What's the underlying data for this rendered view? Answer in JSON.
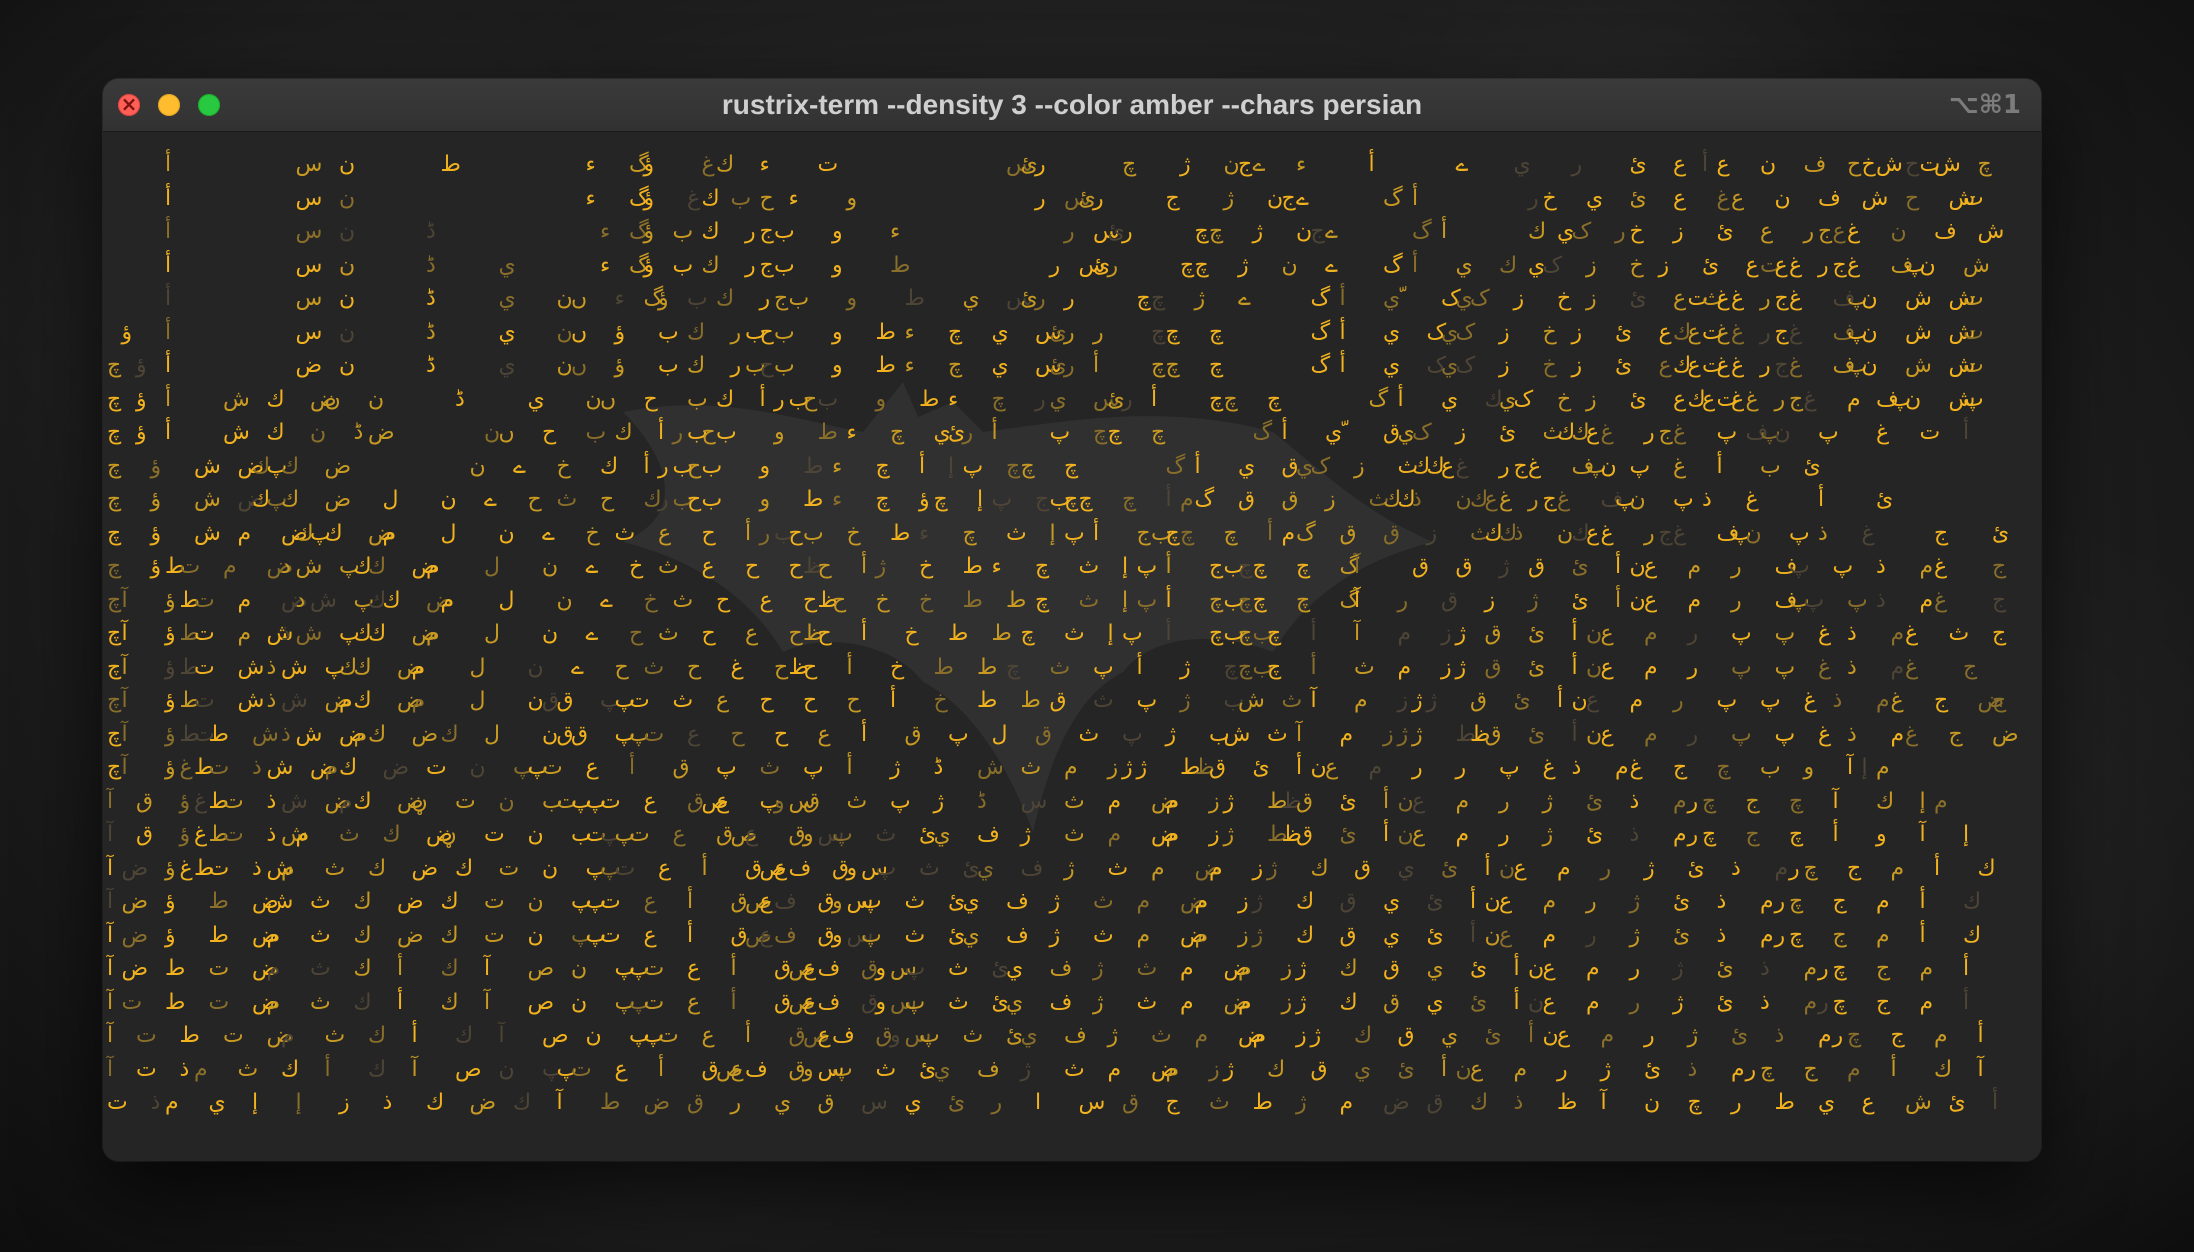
{
  "window": {
    "title": "rustrix-term --density 3 --color amber --chars persian",
    "shortcut": "⌥⌘1"
  },
  "traffic_lights": {
    "close": "close-icon",
    "minimize": "minimize-icon",
    "maximize": "maximize-icon"
  },
  "colors": {
    "bright": "#f2b21e",
    "mid": "#c99a22",
    "dim": "#8a6f2a",
    "faint": "#4e4536"
  },
  "terminal": {
    "rows": [
      "    أ        س  ن      ط         ء  گؤ   غك  ء   ت            سئر     چ   ژ  نجے  ء    أ     ے   ي   ر   ئ  ع أع  ن  ف  حخش حتش  چ     بم",
      "    أ        س  ن                ء  گؤ  غك ب ح ء   و            ر سئر    ج   ژ  نجے     گ أ       رخ  ي  ئ  ع  غع  ن  ف  ش  ح  شت  چ  أ  بم",
      "    أ        س  ن     ڈ           ء گؤ ب ك  رجب   و   ء           ر سئر    چچ  ژ  نجے     گ أ     ك يک  رخ  ز  ئ  ع  رجعغ  ن  ف  ش  ح  شت  چ  أ  بم",
      "    أ        س  ن     ڈ    ي      ء گؤ ب ك  رجب   و   ط          ر سئر    چچ  ژ  ن  ے   گ أ  ي  ك يک  ز  خ ز  ئ  عتعغ رجغ  فپن  ش  ح  شت  أ  بم",
      "    أ        س  ن     ڈ    ي   نں  ء گؤ ب ك  رجب   و   ط   ي  سئر ر    چچ  ژ  ے    گ أ  يّ  کيک  ز  خ ز  ئ  عتثغغ رجغ  فپن  ش  شت  أ  بم  ئ",
      " ؤ  أ        س  ن     ڈ    ي   نں  ؤ  ب ك  ربحب   و  ط ء  چ  ي  سئر ر   چچ  چ      گ أ  ي  کيک  ز  خ ز  ئ  عكعتغغ رجغ  فپن  ش  شت  أ  ضبم  ئ",
      "چ ؤ أ        ض  ن     ڈ    ي   نں  ؤ  ب ك  ربحب   و  ط ء  چ  ي  سئر أ   چچ  چ      گ أ  ي  کيک  ز  خ ز  ئ  عكعتغغ رجغ  فپن  ش  شت  أ  بم  ئ",
      "چ ؤ أ   ش  ك  ضن  ن     ڈ    ي   نں  ح  ب ك  أربحب   و  ط ء  چ  ري  سئر أ   چچ  چ      گ أ  ي  كيک  خ ز  ئ  عكعتغغ رجغ  م فپن  شپ  غ  ت  ت أ  بم  ئ",
      "چ ؤ أ   ش  ك  ن  ڈض       نں  ح  ب ك  أربحب   و  ط ء  چ  يئر أ   پ  چچ  چ      گ أ  يّ  قيک  ز  ئ  ثككعغ  رجغ  پ فپن  پ   غ  ت  أ  بمے  ئ",
      "چ  ؤ  ش  ضكپك  ض         ن  ے  خ  ك  أربحب   و  ط ء  چ  أ إپ  چچ  چ      گ أ  ي  قيک  ز  ثككعغ  رجغ  فپن پ  غ  أ  ب  ئ",
      "چ  ؤ  ش  ضكپك  ض   ل   ن  ے  ح ث  ح  كربحب   و  ط ء  چ  ؤچ  إپ  جبچچ  چ  أمگ  ق  ق  ز  ثككذ  نكعغ رجغ  فپن  پ ذ  غ    أ   ئ",
      "چ  ؤ  ش  م  ضكپك  ضم   ل   ن  ے  خ ث  ع  ح  أربحب  خ  ط ء  چ  ث  إپ أ  جبچچ  چ  أمگ  ق  ق  ز  ثككذ  نكعغ  رجغ  فپن  پ ذ  غ    ج   ئ",
      "چ  ؤطت  م  ضدش  پكك  ضم   ل   ن  ے  خ ث  ع  ح  حظح  أژ  خ  ط ء  چ  ث  إپ أ  جبچچ  چ  گآ   ق  ق  ژ ق  ئ  أنع  م  ر  فپ  پ  ذ  مغ   ج   ئ",
      "چآ  ؤطت  م  ضدش  پكك  ضم   ل   ن  ے  خ ث  ح  ع  حظح  خ  خ  ط  ط چ  ث  إپ أ  چبچچ  چ  گآ  ر  ق  ز  ژ  ئ  أنع  م  ر  فپپ  پ ذ  مغ   ج  آئ",
      "چآ  ؤطت  م شذش  پكك  ضم   ل   ن  ے  ح ث  ح  ع  حظح  أ  خ  ط  ط چ  ث  إپ  أ  چبچبچ  أ  آ  م  زژ ق  ئ  أنع  م  ر  پ  پ  غ ذ  مغ  ث  ج  آئإم",
      "چآ  ؤطت  ش ذش  پكك  ضم   ل   ن  ے  ح ث  ح  غ  حظح  أ  خ  ط  ط چ  ث  پ  أ  ژ  چچبچ  أ  ث  م  زژ ق  ئ  أنع  م  ر  پ  پ  غ ذ  مغ   ج  آئإم",
      "چآ  ؤطت  ش ذش  ضمك  ضم   ل   نقق  پپت  ث  ع  ح  ح  ح  أ  خ  ط  ط ق  ث  پ  ژ  بش  ث آ  م  زژژ  ق  ئ  أنع  م  ر  پ  پ  غ ذ  مغ  ج  ضج  ئآإم",
      "چآ  ؤطتط  ش ذش  ضمك  ض ك  ل   نقق  پپت  ع  ح  ح  ع  أ  ق  پ  ل  ق  ث  پ  ژ  بش  ث آ  م  زژژ  طظق  ئ  أنع  م  ر  پ  پ  غ ذ  مغ  ج  ضج  آإم",
      "چآ  ؤغطت  ذش  ضمك  ض  ت  ن  پپت  ع  أ  ق  پ  ث  پ  أ  ژ  ڈ  ش  ث  م  زژژ  طظق  ئ  أنع  م  ر  ر  پ  غ ذ  مغ  ج  چ  ب  و  آإم",
      "آ ق  ؤغطت  ذش  ضمك  ضڼ  ت  ن  بتپپت  ع  قصع  پوسق  ث  پ  ژ  ڈ  س  ث  م  ضم  زژ  طظق  ئ  أنع  م  ر  ژ  ئ  ذ  مرچ  ج  چ  آ  ك  إم",
      "آ ق  ؤغطت  ذشم  ث  ك  ضڼ  ت  ن  بتپپت  ع  قصع  قوسپ  ث  ئي  ف  ژ  ث  م  ضم  زژ  طظق  ئ  أنع  م  ر  ژ  ئ  ذ  مرچ  ج  چ  أ  و  آ  إ",
      "آض  ؤغطت  ذشم  ث  ك  ض  ك  ت  ن  پپت  ع  أ  قصعف  قوسپ  ث  ئي  ف  ژ  ث  م  ضم  زژ  ك  ق  ي  ئ  أنع  م  ر  ژ  ئ  ذ  مرچ  ج  م  أ  ك  آ  إ",
      "آض  ؤ  ط  ضش  ث  ك  ض  ك  ت  ن  پپت  ع  أ  قصعف  قوسپ  ث  ئي  ف  ژ  ث  م  ضم  زژ  ك  ق  ي  ئ  أنع  م  ر  ژ  ئ  ذ  مرچ  ج  م  أ  ك  آ  إ",
      "آض  ؤ  ط  ضم  ث  ك  ض  ك  ت  ن  پپت  ع  أ  قصعف  قوسپ  ث  ئي  ف  ژ  ث  م  ضم  زژ  ك  ق  ي  ئ  أنع  م  ر  ژ  ئ  ذ  مرچ  ج  م  أ  ك  آ  إ",
      "آض  ط  ت  ضم  ث  ك  أ  ك  آ  ص  ن  پپت  ع  أ  قصعف  قوسپ  ث  ئي  ف  ژ  ث  م  ضم  زژ  ك  ق  ي  ئ  أنع  م  ر  ژ  ئ  ذ  مرچ  ج  م  أ  ك  آ  إ",
      "آت  ط  ت  ضم  ث  ك  أ  ك  آ  ص  ن  پپت  ع  أ  قصعف  قوسپ  ث  ئي  ف  ژ  ث  م  ضم  زژ  ك  ق  ي  ئ  أنع  م  ر  ژ  ئ  ذ  مرچ  ج  م  أ  ك  آ  إ",
      "آ ت  ط  ت  ضم  ث  ك  أ  ك  آ  ص  ن  پپت  ع  أ  قصعف  قوسپ  ث  ئي  ف  ژ  ث  م  ضم  زژ  ك  ق  ي  ئ  أنع  م  ر  ژ  ئ  ذ  مرچ  ج  م  أ  ك  آ  إ",
      "آ ت  ذم  ث  ك  أ  ك  آ  ص  ن  پپت  ع  أ  قصعف  قوسپ  ث  ئي  ف  ژ  ث  م  ضم  زژ  ك  ق  ي  ئ  أنع  م  ر  ژ  ئ  ذ  مرچ  ج  م  أ  ك  آ  إ",
      "ت  ذم  ي  إ  إ  ز  ذ  ك  ض  ك  آ  ط  ض  ق  ر  ي  ق  س  ي  ئ  ر  ا  س  ق  ج  ث  ط  ژ  م  ض  ق  ك  ذ  ظ  آ  ن  چ  ر  ط  ي  ع  ش  ئ  أ"
    ]
  }
}
